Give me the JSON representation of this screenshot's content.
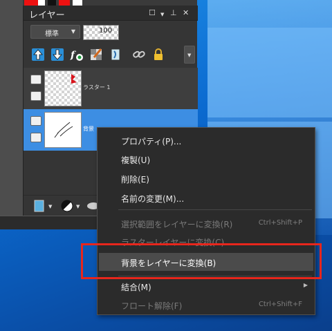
{
  "panel": {
    "title": "レイヤー",
    "blend_mode": "標準",
    "opacity": "100"
  },
  "layers": [
    {
      "name": "ラスター 1",
      "selected": false
    },
    {
      "name": "背景",
      "selected": true
    }
  ],
  "context_menu": {
    "items": [
      {
        "label": "プロパティ(P)...",
        "enabled": true
      },
      {
        "label": "複製(U)",
        "enabled": true
      },
      {
        "label": "削除(E)",
        "enabled": true
      },
      {
        "label": "名前の変更(M)...",
        "enabled": true
      },
      {
        "label": "選択範囲をレイヤーに変換(R)",
        "enabled": false,
        "shortcut": "Ctrl+Shift+P"
      },
      {
        "label": "ラスターレイヤーに変換(C)",
        "enabled": false
      },
      {
        "label": "背景をレイヤーに変換(B)",
        "enabled": true,
        "highlighted": true
      },
      {
        "label": "結合(M)",
        "enabled": true,
        "submenu": true
      },
      {
        "label": "フロート解除(F)",
        "enabled": false,
        "shortcut": "Ctrl+Shift+F"
      }
    ]
  },
  "colors": {
    "selection_blue": "#3d8ee3",
    "annotation_red": "#e8261c",
    "menu_bg": "#2b2b2b"
  }
}
